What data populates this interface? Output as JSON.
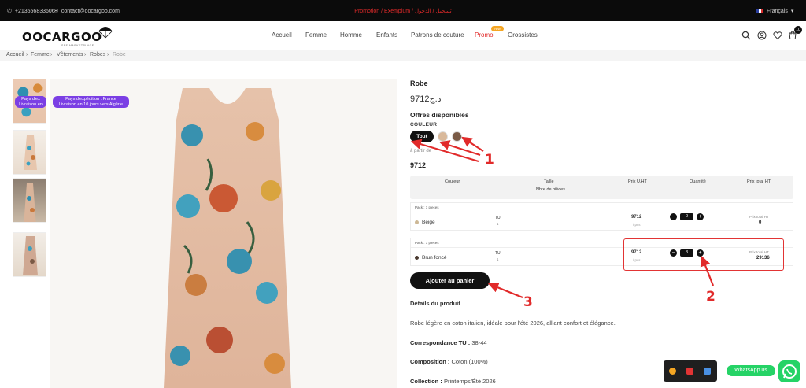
{
  "topbar": {
    "phone": "+213556833606",
    "email": "contact@oocargoo.com",
    "promo_message": "Promotion / Exemplum / تسجيل / الدخول",
    "language": "Français"
  },
  "header": {
    "logo_text": "OOCARGOO",
    "logo_sub": "SEE MARKETPLACE",
    "nav": [
      "Accueil",
      "Femme",
      "Homme",
      "Enfants",
      "Patrons de couture",
      "Promo",
      "Grossistes"
    ],
    "promo_badge": "new",
    "cart_count": "10"
  },
  "breadcrumb": [
    "Accueil",
    "Femme",
    "Vêtements",
    "Robes",
    "Robe"
  ],
  "gallery": {
    "badge_main": [
      "Pays d'expédition : France",
      "Livraison en 10 jours vers Algérie"
    ],
    "badge_thumb": [
      "Pays d'ex",
      "Livraison en"
    ]
  },
  "product": {
    "title": "Robe",
    "price": "9712د.ج",
    "offers_title": "Offres disponibles",
    "color_label": "COULEUR",
    "color_all": "Tout",
    "swatch_colors": [
      "#d9b99b",
      "#7a5a46"
    ],
    "from_label": "à partir de",
    "big_price": "9712",
    "add_to_cart": "Ajouter au panier"
  },
  "table": {
    "headers": {
      "color": "Couleur",
      "size": "Taille",
      "pieces": "Nbre de pièces",
      "unit_price": "Prix U.HT",
      "quantity": "Quantité",
      "total": "Prix total HT"
    },
    "rows": [
      {
        "pack": "Pack : 1 pieces",
        "name": "Beige",
        "dot": "#cdb896",
        "size": "TU",
        "pieces": "1",
        "price": "9712",
        "unit": "/ pcs",
        "qty": "0",
        "total_label": "Prix total HT",
        "total": "0"
      },
      {
        "pack": "Pack : 1 pieces",
        "name": "Brun foncé",
        "dot": "#4a3a30",
        "size": "TU",
        "pieces": "1",
        "price": "9712",
        "unit": "/ pcs",
        "qty": "3",
        "total_label": "Prix total HT",
        "total": "29136"
      }
    ]
  },
  "details": {
    "heading": "Détails du produit",
    "description": "Robe légère en coton italien, idéale pour l'été 2026, alliant confort et élégance.",
    "correspondance_label": "Correspondance TU :",
    "correspondance_value": "38-44",
    "composition_label": "Composition :",
    "composition_value": "Coton (100%)",
    "collection_label": "Collection :",
    "collection_value": "Printemps/Été 2026"
  },
  "annotations": [
    "1",
    "2",
    "3"
  ],
  "whatsapp": {
    "label": "WhatsApp us"
  },
  "colors": {
    "accent": "#e12a2a",
    "dark": "#111111",
    "purple": "#7b3fe4",
    "whatsapp": "#25d366"
  }
}
